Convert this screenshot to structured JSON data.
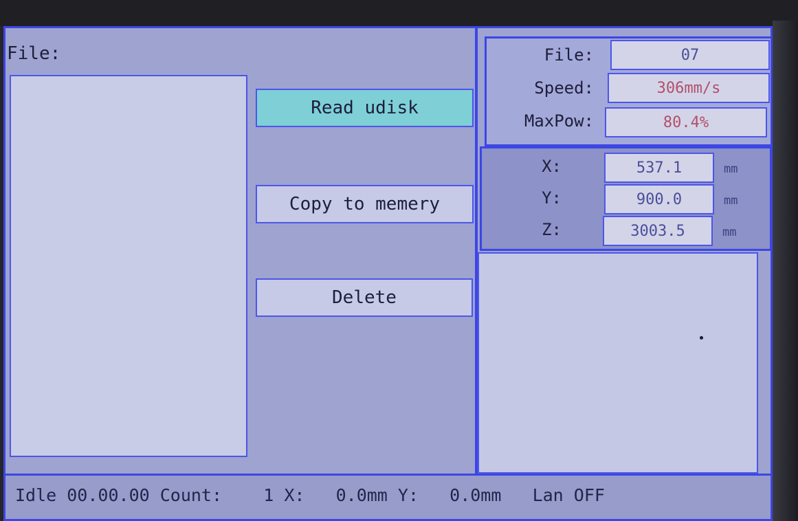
{
  "left_panel": {
    "file_label": "File:"
  },
  "buttons": {
    "read_udisk": "Read udisk",
    "copy_to_memory": "Copy to memery",
    "delete": "Delete"
  },
  "info": {
    "file_label": "File:",
    "file_value": "07",
    "speed_label": "Speed:",
    "speed_value": "306mm/s",
    "maxpow_label": "MaxPow:",
    "maxpow_value": "80.4%"
  },
  "coords": {
    "x_label": "X:",
    "x_value": "537.1",
    "y_label": "Y:",
    "y_value": "900.0",
    "z_label": "Z:",
    "z_value": "3003.5",
    "unit": "mm"
  },
  "status_bar": {
    "text": "Idle 00.00.00 Count:    1 X:   0.0mm Y:   0.0mm   Lan OFF"
  },
  "colors": {
    "screen_bg": "#9ea3d0",
    "border": "#3c46e4",
    "button_active": "#7ecfd6",
    "value_red": "#b0506a"
  }
}
